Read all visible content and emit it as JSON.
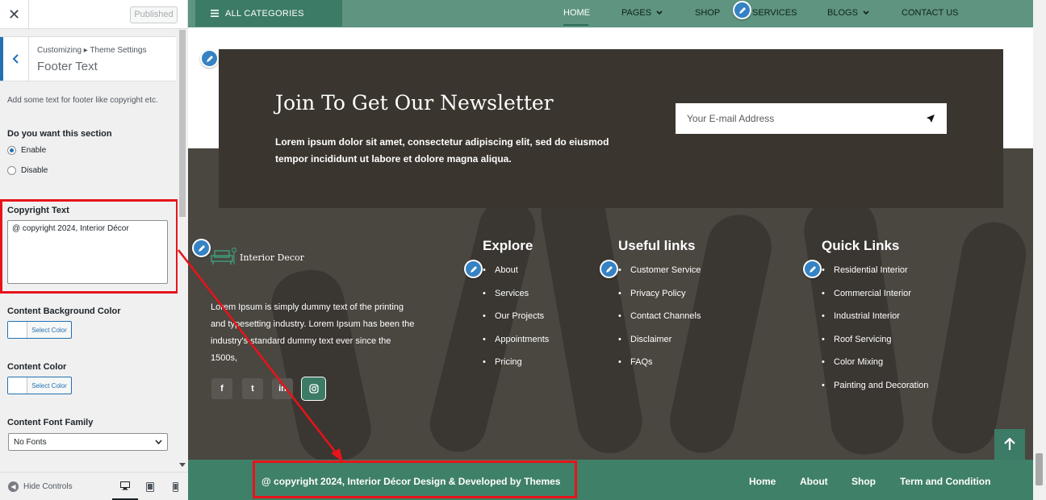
{
  "panel": {
    "close": "✕",
    "published": "Published",
    "breadcrumb": "Customizing ▸ Theme Settings",
    "section_title": "Footer Text",
    "description": "Add some text for footer like copyright etc.",
    "section_toggle_label": "Do you want this section",
    "radio_enable": "Enable",
    "radio_disable": "Disable",
    "copyright_label": "Copyright Text",
    "copyright_value": "@ copyright 2024, Interior Décor",
    "bg_color_label": "Content Background Color",
    "select_color": "Select Color",
    "content_color_label": "Content Color",
    "font_family_label": "Content Font Family",
    "font_family_value": "No Fonts",
    "hide_controls": "Hide Controls"
  },
  "nav": {
    "all_categories": "ALL CATEGORIES",
    "home": "HOME",
    "pages": "PAGES",
    "shop": "SHOP",
    "services": "SERVICES",
    "blogs": "BLOGS",
    "contact": "CONTACT US"
  },
  "newsletter": {
    "title": "Join To Get Our Newsletter",
    "text": "Lorem ipsum dolor sit amet, consectetur adipiscing elit, sed do eiusmod tempor incididunt ut labore et dolore magna aliqua.",
    "placeholder": "Your E-mail Address"
  },
  "footer": {
    "logo_text": "Interior Decor",
    "about": "Lorem Ipsum is simply dummy text of the printing and typesetting industry. Lorem Ipsum has been the industry's standard dummy text ever since the 1500s,",
    "social": [
      "f",
      "t",
      "in",
      "ig"
    ],
    "explore": {
      "title": "Explore",
      "items": [
        "About",
        "Services",
        "Our Projects",
        "Appointments",
        "Pricing"
      ]
    },
    "useful": {
      "title": "Useful links",
      "items": [
        "Customer Service",
        "Privacy Policy",
        "Contact Channels",
        "Disclaimer",
        "FAQs"
      ]
    },
    "quick": {
      "title": "Quick Links",
      "items": [
        "Residential Interior",
        "Commercial Interior",
        "Industrial Interior",
        "Roof Servicing",
        "Color Mixing",
        "Painting and Decoration"
      ]
    },
    "copyright": "@ copyright 2024, Interior Décor Design & Developed by Themes",
    "links": [
      "Home",
      "About",
      "Shop",
      "Term and Condition"
    ]
  },
  "colors": {
    "accent_green": "#3c7b66",
    "highlight_red": "#e8131a",
    "wp_blue": "#2271b1"
  }
}
